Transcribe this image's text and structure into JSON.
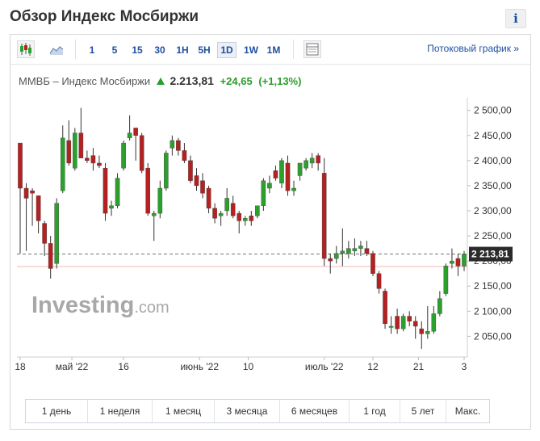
{
  "header": {
    "title": "Обзор Индекс Мосбиржи",
    "info_label": "i"
  },
  "toolbar": {
    "chart_type_icons": [
      "candlestick-icon",
      "area-chart-icon"
    ],
    "intervals": [
      "1",
      "5",
      "15",
      "30",
      "1H",
      "5H",
      "1D",
      "1W",
      "1M"
    ],
    "active_interval": "1D",
    "settings_icon": "chart-settings-icon",
    "stream_link": "Потоковый график »"
  },
  "quote": {
    "name": "ММВБ – Индекс Мосбиржи",
    "price": "2.213,81",
    "change": "+24,65",
    "change_pct": "(+1,13%)",
    "up_color": "#2a9c2a"
  },
  "watermark": {
    "brand": "Investing",
    "suffix": ".com"
  },
  "chart_data": {
    "type": "candlestick",
    "y_ticks": [
      "2 500,00",
      "2 450,00",
      "2 400,00",
      "2 350,00",
      "2 300,00",
      "2 250,00",
      "2 200,00",
      "2 150,00",
      "2 100,00",
      "2 050,00"
    ],
    "y_tick_values": [
      2500,
      2450,
      2400,
      2350,
      2300,
      2250,
      2200,
      2150,
      2100,
      2050
    ],
    "ylim": [
      2012,
      2522
    ],
    "x_ticks": [
      "18",
      "май '22",
      "16",
      "июнь '22",
      "10",
      "июль '22",
      "12",
      "21",
      "3"
    ],
    "x_tick_index": [
      0,
      8.5,
      17,
      29.5,
      37.5,
      50,
      58,
      65.5,
      73
    ],
    "last_price_label": "2 213,81",
    "last_price": 2213.81,
    "reference_line": 2189,
    "up_color": "#2ca02c",
    "down_color": "#b52020",
    "candles": [
      {
        "o": 2435,
        "h": 2435,
        "l": 2215,
        "c": 2345
      },
      {
        "o": 2345,
        "h": 2355,
        "l": 2220,
        "c": 2325
      },
      {
        "o": 2340,
        "h": 2345,
        "l": 2270,
        "c": 2335
      },
      {
        "o": 2330,
        "h": 2330,
        "l": 2255,
        "c": 2280
      },
      {
        "o": 2275,
        "h": 2280,
        "l": 2210,
        "c": 2235
      },
      {
        "o": 2235,
        "h": 2250,
        "l": 2165,
        "c": 2185
      },
      {
        "o": 2195,
        "h": 2325,
        "l": 2185,
        "c": 2315
      },
      {
        "o": 2340,
        "h": 2470,
        "l": 2335,
        "c": 2445
      },
      {
        "o": 2440,
        "h": 2480,
        "l": 2390,
        "c": 2395
      },
      {
        "o": 2385,
        "h": 2465,
        "l": 2380,
        "c": 2455
      },
      {
        "o": 2455,
        "h": 2505,
        "l": 2415,
        "c": 2405
      },
      {
        "o": 2405,
        "h": 2420,
        "l": 2395,
        "c": 2400
      },
      {
        "o": 2410,
        "h": 2425,
        "l": 2380,
        "c": 2395
      },
      {
        "o": 2395,
        "h": 2410,
        "l": 2385,
        "c": 2390
      },
      {
        "o": 2385,
        "h": 2395,
        "l": 2280,
        "c": 2295
      },
      {
        "o": 2305,
        "h": 2320,
        "l": 2290,
        "c": 2310
      },
      {
        "o": 2310,
        "h": 2375,
        "l": 2305,
        "c": 2365
      },
      {
        "o": 2385,
        "h": 2440,
        "l": 2380,
        "c": 2435
      },
      {
        "o": 2445,
        "h": 2490,
        "l": 2440,
        "c": 2455
      },
      {
        "o": 2465,
        "h": 2460,
        "l": 2400,
        "c": 2450
      },
      {
        "o": 2450,
        "h": 2455,
        "l": 2375,
        "c": 2380
      },
      {
        "o": 2385,
        "h": 2395,
        "l": 2290,
        "c": 2295
      },
      {
        "o": 2290,
        "h": 2300,
        "l": 2240,
        "c": 2295
      },
      {
        "o": 2295,
        "h": 2360,
        "l": 2285,
        "c": 2345
      },
      {
        "o": 2345,
        "h": 2420,
        "l": 2340,
        "c": 2415
      },
      {
        "o": 2425,
        "h": 2450,
        "l": 2410,
        "c": 2440
      },
      {
        "o": 2440,
        "h": 2445,
        "l": 2410,
        "c": 2420
      },
      {
        "o": 2420,
        "h": 2435,
        "l": 2395,
        "c": 2400
      },
      {
        "o": 2400,
        "h": 2410,
        "l": 2355,
        "c": 2360
      },
      {
        "o": 2370,
        "h": 2385,
        "l": 2340,
        "c": 2350
      },
      {
        "o": 2360,
        "h": 2375,
        "l": 2325,
        "c": 2335
      },
      {
        "o": 2345,
        "h": 2350,
        "l": 2295,
        "c": 2305
      },
      {
        "o": 2305,
        "h": 2315,
        "l": 2275,
        "c": 2285
      },
      {
        "o": 2290,
        "h": 2300,
        "l": 2270,
        "c": 2295
      },
      {
        "o": 2300,
        "h": 2345,
        "l": 2290,
        "c": 2325
      },
      {
        "o": 2315,
        "h": 2330,
        "l": 2285,
        "c": 2290
      },
      {
        "o": 2295,
        "h": 2300,
        "l": 2255,
        "c": 2280
      },
      {
        "o": 2280,
        "h": 2290,
        "l": 2270,
        "c": 2285
      },
      {
        "o": 2290,
        "h": 2300,
        "l": 2270,
        "c": 2280
      },
      {
        "o": 2290,
        "h": 2305,
        "l": 2285,
        "c": 2310
      },
      {
        "o": 2310,
        "h": 2365,
        "l": 2300,
        "c": 2360
      },
      {
        "o": 2345,
        "h": 2370,
        "l": 2335,
        "c": 2355
      },
      {
        "o": 2380,
        "h": 2390,
        "l": 2360,
        "c": 2365
      },
      {
        "o": 2355,
        "h": 2405,
        "l": 2345,
        "c": 2400
      },
      {
        "o": 2395,
        "h": 2410,
        "l": 2330,
        "c": 2340
      },
      {
        "o": 2340,
        "h": 2360,
        "l": 2330,
        "c": 2345
      },
      {
        "o": 2370,
        "h": 2390,
        "l": 2360,
        "c": 2395
      },
      {
        "o": 2385,
        "h": 2405,
        "l": 2380,
        "c": 2400
      },
      {
        "o": 2395,
        "h": 2415,
        "l": 2385,
        "c": 2405
      },
      {
        "o": 2410,
        "h": 2415,
        "l": 2380,
        "c": 2395
      },
      {
        "o": 2375,
        "h": 2405,
        "l": 2190,
        "c": 2205
      },
      {
        "o": 2205,
        "h": 2215,
        "l": 2175,
        "c": 2200
      },
      {
        "o": 2205,
        "h": 2230,
        "l": 2195,
        "c": 2215
      },
      {
        "o": 2215,
        "h": 2265,
        "l": 2190,
        "c": 2220
      },
      {
        "o": 2215,
        "h": 2240,
        "l": 2205,
        "c": 2225
      },
      {
        "o": 2220,
        "h": 2245,
        "l": 2210,
        "c": 2225
      },
      {
        "o": 2225,
        "h": 2240,
        "l": 2210,
        "c": 2230
      },
      {
        "o": 2225,
        "h": 2240,
        "l": 2210,
        "c": 2215
      },
      {
        "o": 2215,
        "h": 2220,
        "l": 2170,
        "c": 2175
      },
      {
        "o": 2175,
        "h": 2180,
        "l": 2135,
        "c": 2145
      },
      {
        "o": 2140,
        "h": 2145,
        "l": 2065,
        "c": 2075
      },
      {
        "o": 2070,
        "h": 2090,
        "l": 2055,
        "c": 2070
      },
      {
        "o": 2090,
        "h": 2105,
        "l": 2055,
        "c": 2065
      },
      {
        "o": 2065,
        "h": 2095,
        "l": 2060,
        "c": 2090
      },
      {
        "o": 2090,
        "h": 2100,
        "l": 2070,
        "c": 2080
      },
      {
        "o": 2080,
        "h": 2090,
        "l": 2045,
        "c": 2070
      },
      {
        "o": 2065,
        "h": 2080,
        "l": 2025,
        "c": 2055
      },
      {
        "o": 2055,
        "h": 2110,
        "l": 2045,
        "c": 2060
      },
      {
        "o": 2060,
        "h": 2110,
        "l": 2055,
        "c": 2095
      },
      {
        "o": 2095,
        "h": 2140,
        "l": 2090,
        "c": 2125
      },
      {
        "o": 2135,
        "h": 2195,
        "l": 2130,
        "c": 2190
      },
      {
        "o": 2195,
        "h": 2225,
        "l": 2185,
        "c": 2200
      },
      {
        "o": 2205,
        "h": 2215,
        "l": 2170,
        "c": 2190
      },
      {
        "o": 2190,
        "h": 2220,
        "l": 2180,
        "c": 2214
      }
    ]
  },
  "ranges": [
    {
      "label": "1 день",
      "w": 76
    },
    {
      "label": "1 неделя",
      "w": 79
    },
    {
      "label": "1 месяц",
      "w": 76
    },
    {
      "label": "3 месяца",
      "w": 80
    },
    {
      "label": "6 месяцев",
      "w": 85
    },
    {
      "label": "1 год",
      "w": 62
    },
    {
      "label": "5 лет",
      "w": 56
    },
    {
      "label": "Макс.",
      "w": 53
    }
  ]
}
